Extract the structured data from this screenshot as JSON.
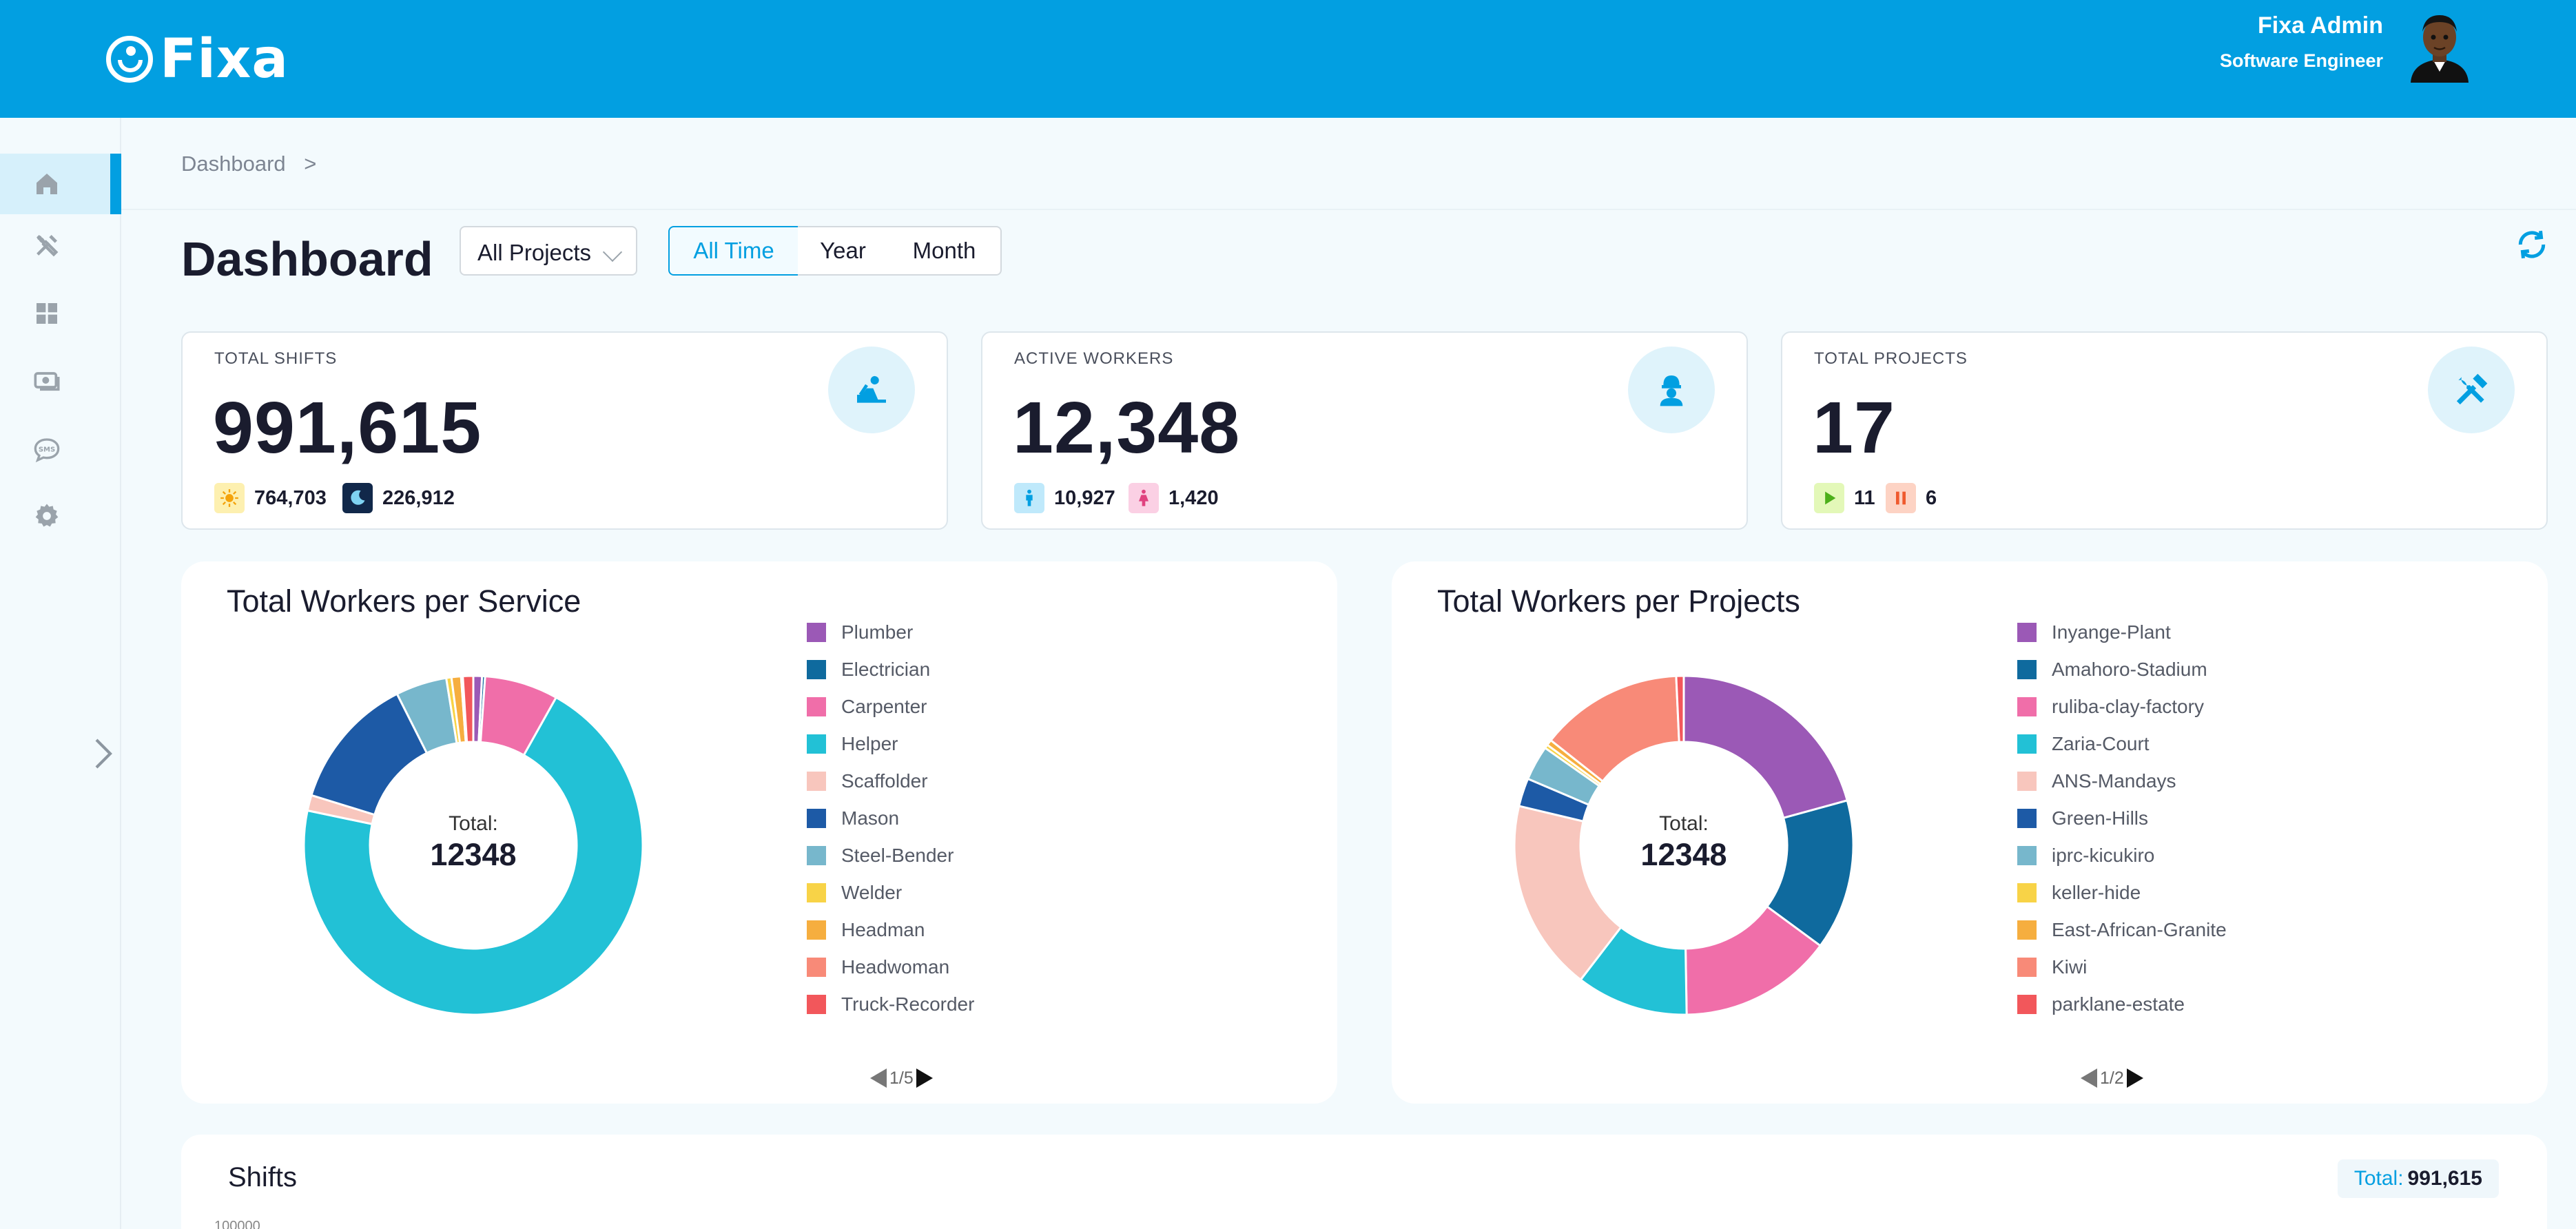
{
  "app": {
    "logo_text": "Fixa",
    "user_name": "Fixa Admin",
    "user_role": "Software Engineer"
  },
  "sidebar": {
    "items": [
      {
        "icon": "home-icon",
        "active": true
      },
      {
        "icon": "tools-icon"
      },
      {
        "icon": "grid-icon"
      },
      {
        "icon": "money-icon"
      },
      {
        "icon": "sms-icon"
      },
      {
        "icon": "settings-icon"
      }
    ],
    "sms_badge": "SMS"
  },
  "breadcrumb": {
    "text": "Dashboard",
    "separator": ">"
  },
  "page_title": "Dashboard",
  "filters": {
    "project_select": "All Projects",
    "time_tabs": [
      "All Time",
      "Year",
      "Month"
    ],
    "selected_tab": "All Time"
  },
  "stats": {
    "total_shifts": {
      "label": "TOTAL SHIFTS",
      "value": "991,615",
      "day": "764,703",
      "night": "226,912"
    },
    "active_workers": {
      "label": "ACTIVE WORKERS",
      "value": "12,348",
      "male": "10,927",
      "female": "1,420"
    },
    "total_projects": {
      "label": "TOTAL PROJECTS",
      "value": "17",
      "active": "11",
      "paused": "6"
    }
  },
  "colors": {
    "brand": "#029fe1",
    "text_dark": "#1a1c2e"
  },
  "chart_data": [
    {
      "type": "pie",
      "title": "Total Workers per Service",
      "center_label": "Total:",
      "center_value": "12348",
      "pager": "1/5",
      "legend": [
        "Plumber",
        "Electrician",
        "Carpenter",
        "Helper",
        "Scaffolder",
        "Mason",
        "Steel-Bender",
        "Welder",
        "Headman",
        "Headwoman",
        "Truck-Recorder"
      ],
      "legend_colors": [
        "#9b59b6",
        "#0f6a9e",
        "#f06ea9",
        "#22c1d6",
        "#f8c6bd",
        "#1d5aa6",
        "#77b7cc",
        "#f8d347",
        "#f6ae3f",
        "#f88a78",
        "#f2575b"
      ],
      "values": [
        100,
        35,
        850,
        8500,
        180,
        1550,
        590,
        60,
        110,
        20,
        120
      ]
    },
    {
      "type": "pie",
      "title": "Total Workers per Projects",
      "center_label": "Total:",
      "center_value": "12348",
      "pager": "1/2",
      "legend": [
        "Inyange-Plant",
        "Amahoro-Stadium",
        "ruliba-clay-factory",
        "Zaria-Court",
        "ANS-Mandays",
        "Green-Hills",
        "iprc-kicukiro",
        "keller-hide",
        "East-African-Granite",
        "Kiwi",
        "parklane-estate"
      ],
      "legend_colors": [
        "#9b59b6",
        "#0f6a9e",
        "#f06ea9",
        "#22c1d6",
        "#f8c6bd",
        "#1d5aa6",
        "#77b7cc",
        "#f8d347",
        "#f6ae3f",
        "#f88a78",
        "#f2575b"
      ],
      "values": [
        2310,
        1600,
        1630,
        1190,
        2040,
        300,
        370,
        40,
        60,
        1520,
        80
      ]
    }
  ],
  "shifts": {
    "title": "Shifts",
    "total_label": "Total:",
    "total_value": "991,615",
    "y_tick": "100000"
  }
}
